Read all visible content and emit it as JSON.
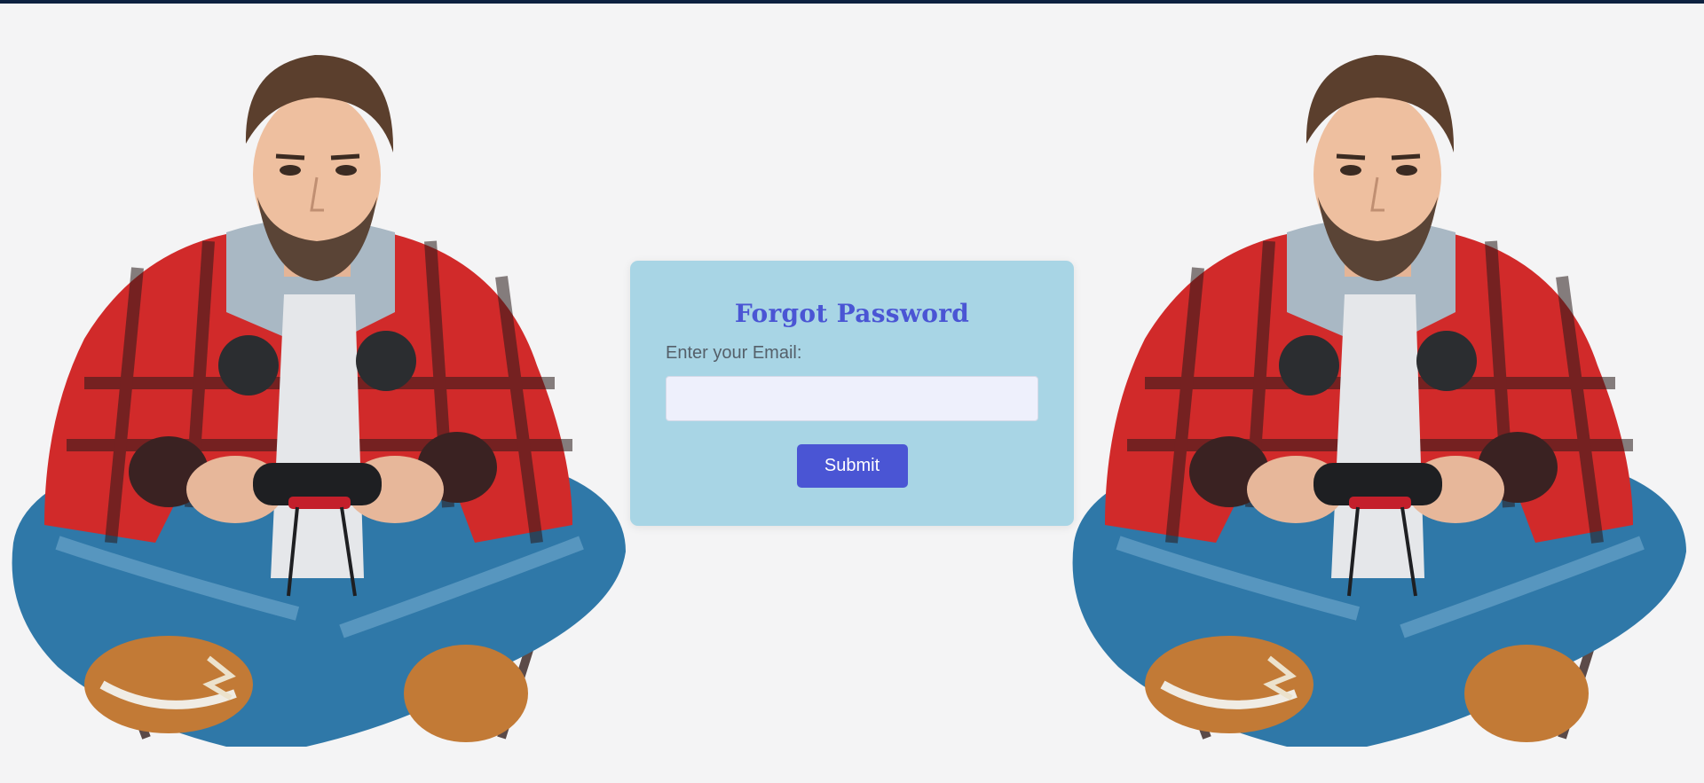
{
  "form": {
    "title": "Forgot Password",
    "email_label": "Enter your Email:",
    "email_value": "",
    "email_placeholder": "",
    "submit_label": "Submit"
  },
  "illustrations": [
    {
      "name": "gamer-illustration-left"
    },
    {
      "name": "gamer-illustration-right"
    }
  ],
  "colors": {
    "page_background": "#f4f4f5",
    "top_bar": "#0d2140",
    "card_background": "#a8d5e5",
    "accent": "#4a55d4",
    "input_background": "#eef0fc",
    "jacket_red": "#d12a2a",
    "jeans_blue": "#2f78a8"
  }
}
